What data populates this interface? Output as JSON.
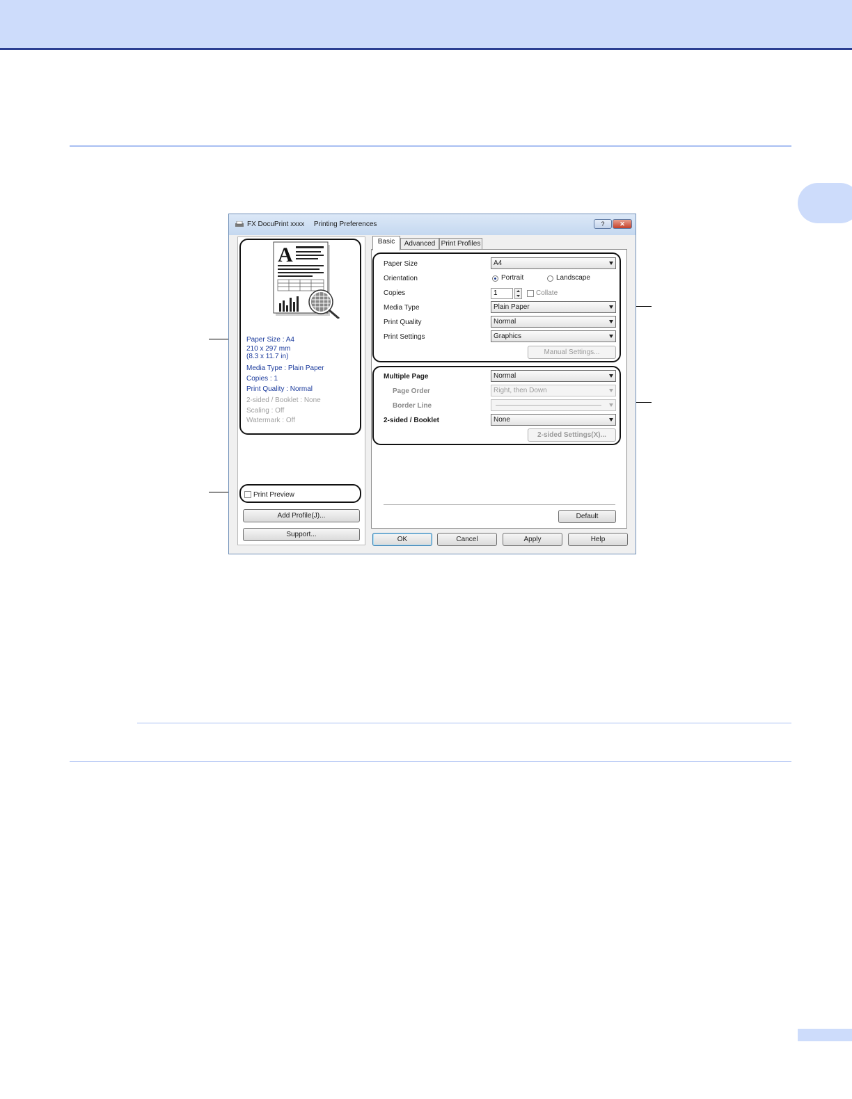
{
  "dialog": {
    "app_name": "FX DocuPrint xxxx",
    "title": "Printing Preferences",
    "help_label": "?",
    "close_label": "✕"
  },
  "left_pane": {
    "info": {
      "paper_size": "Paper Size : A4",
      "size_mm": "210 x 297 mm",
      "size_in": "(8.3 x 11.7 in)",
      "media_type": "Media Type : Plain Paper",
      "copies": "Copies : 1",
      "print_quality": "Print Quality : Normal",
      "two_sided": "2-sided / Booklet : None",
      "scaling": "Scaling : Off",
      "watermark": "Watermark : Off"
    },
    "print_preview_label": "Print Preview",
    "add_profile_label": "Add Profile(J)...",
    "support_label": "Support..."
  },
  "tabs": [
    "Basic",
    "Advanced",
    "Print Profiles"
  ],
  "basic": {
    "paper_size": {
      "label": "Paper Size",
      "value": "A4"
    },
    "orientation": {
      "label": "Orientation",
      "portrait": "Portrait",
      "landscape": "Landscape"
    },
    "copies": {
      "label": "Copies",
      "value": "1",
      "collate": "Collate"
    },
    "media_type": {
      "label": "Media Type",
      "value": "Plain Paper"
    },
    "print_quality": {
      "label": "Print Quality",
      "value": "Normal"
    },
    "print_settings": {
      "label": "Print Settings",
      "value": "Graphics"
    },
    "manual_settings_label": "Manual Settings...",
    "multiple_page": {
      "label": "Multiple Page",
      "value": "Normal"
    },
    "page_order": {
      "label": "Page Order",
      "value": "Right, then Down"
    },
    "border_line": {
      "label": "Border Line",
      "value": ""
    },
    "two_sided": {
      "label": "2-sided / Booklet",
      "value": "None"
    },
    "two_sided_settings_label": "2-sided Settings(X)...",
    "default_label": "Default"
  },
  "footer": {
    "ok": "OK",
    "cancel": "Cancel",
    "apply": "Apply",
    "help": "Help"
  },
  "colors": {
    "header_band": "#cddcfb",
    "header_rule": "#2b3f92",
    "page_rule": "#a9bff2",
    "info_text": "#1a3a9c"
  }
}
